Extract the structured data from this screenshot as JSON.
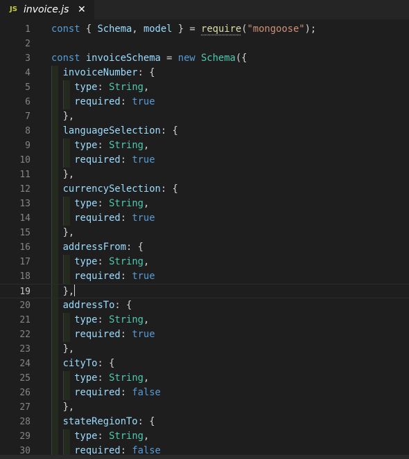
{
  "tab": {
    "badge": "JS",
    "filename": "invoice.js",
    "close_glyph": "✕"
  },
  "editor": {
    "current_line": 19,
    "lines": [
      {
        "n": "1",
        "tokens": [
          {
            "t": "const",
            "c": "kw"
          },
          {
            "t": " { ",
            "c": "pun"
          },
          {
            "t": "Schema",
            "c": "var"
          },
          {
            "t": ", ",
            "c": "pun"
          },
          {
            "t": "model",
            "c": "var"
          },
          {
            "t": " } = ",
            "c": "pun"
          },
          {
            "t": "require",
            "c": "fn squiggle"
          },
          {
            "t": "(",
            "c": "pun"
          },
          {
            "t": "\"mongoose\"",
            "c": "str"
          },
          {
            "t": ");",
            "c": "pun"
          }
        ]
      },
      {
        "n": "2",
        "tokens": []
      },
      {
        "n": "3",
        "tokens": [
          {
            "t": "const",
            "c": "kw"
          },
          {
            "t": " ",
            "c": "pun"
          },
          {
            "t": "invoiceSchema",
            "c": "var"
          },
          {
            "t": " = ",
            "c": "pun"
          },
          {
            "t": "new",
            "c": "kw"
          },
          {
            "t": " ",
            "c": "pun"
          },
          {
            "t": "Schema",
            "c": "cls"
          },
          {
            "t": "({",
            "c": "pun"
          }
        ]
      },
      {
        "n": "4",
        "tokens": [
          {
            "t": "  ",
            "c": "pun"
          },
          {
            "t": "invoiceNumber",
            "c": "prop"
          },
          {
            "t": ": {",
            "c": "pun"
          }
        ]
      },
      {
        "n": "5",
        "tokens": [
          {
            "t": "    ",
            "c": "pun"
          },
          {
            "t": "type",
            "c": "prop"
          },
          {
            "t": ": ",
            "c": "pun"
          },
          {
            "t": "String",
            "c": "cls"
          },
          {
            "t": ",",
            "c": "pun"
          }
        ]
      },
      {
        "n": "6",
        "tokens": [
          {
            "t": "    ",
            "c": "pun"
          },
          {
            "t": "required",
            "c": "prop"
          },
          {
            "t": ": ",
            "c": "pun"
          },
          {
            "t": "true",
            "c": "kw"
          }
        ]
      },
      {
        "n": "7",
        "tokens": [
          {
            "t": "  },",
            "c": "pun"
          }
        ]
      },
      {
        "n": "8",
        "tokens": [
          {
            "t": "  ",
            "c": "pun"
          },
          {
            "t": "languageSelection",
            "c": "prop"
          },
          {
            "t": ": {",
            "c": "pun"
          }
        ]
      },
      {
        "n": "9",
        "tokens": [
          {
            "t": "    ",
            "c": "pun"
          },
          {
            "t": "type",
            "c": "prop"
          },
          {
            "t": ": ",
            "c": "pun"
          },
          {
            "t": "String",
            "c": "cls"
          },
          {
            "t": ",",
            "c": "pun"
          }
        ]
      },
      {
        "n": "10",
        "tokens": [
          {
            "t": "    ",
            "c": "pun"
          },
          {
            "t": "required",
            "c": "prop"
          },
          {
            "t": ": ",
            "c": "pun"
          },
          {
            "t": "true",
            "c": "kw"
          }
        ]
      },
      {
        "n": "11",
        "tokens": [
          {
            "t": "  },",
            "c": "pun"
          }
        ]
      },
      {
        "n": "12",
        "tokens": [
          {
            "t": "  ",
            "c": "pun"
          },
          {
            "t": "currencySelection",
            "c": "prop"
          },
          {
            "t": ": {",
            "c": "pun"
          }
        ]
      },
      {
        "n": "13",
        "tokens": [
          {
            "t": "    ",
            "c": "pun"
          },
          {
            "t": "type",
            "c": "prop"
          },
          {
            "t": ": ",
            "c": "pun"
          },
          {
            "t": "String",
            "c": "cls"
          },
          {
            "t": ",",
            "c": "pun"
          }
        ]
      },
      {
        "n": "14",
        "tokens": [
          {
            "t": "    ",
            "c": "pun"
          },
          {
            "t": "required",
            "c": "prop"
          },
          {
            "t": ": ",
            "c": "pun"
          },
          {
            "t": "true",
            "c": "kw"
          }
        ]
      },
      {
        "n": "15",
        "tokens": [
          {
            "t": "  },",
            "c": "pun"
          }
        ]
      },
      {
        "n": "16",
        "tokens": [
          {
            "t": "  ",
            "c": "pun"
          },
          {
            "t": "addressFrom",
            "c": "prop"
          },
          {
            "t": ": {",
            "c": "pun"
          }
        ]
      },
      {
        "n": "17",
        "tokens": [
          {
            "t": "    ",
            "c": "pun"
          },
          {
            "t": "type",
            "c": "prop"
          },
          {
            "t": ": ",
            "c": "pun"
          },
          {
            "t": "String",
            "c": "cls"
          },
          {
            "t": ",",
            "c": "pun"
          }
        ]
      },
      {
        "n": "18",
        "tokens": [
          {
            "t": "    ",
            "c": "pun"
          },
          {
            "t": "required",
            "c": "prop"
          },
          {
            "t": ": ",
            "c": "pun"
          },
          {
            "t": "true",
            "c": "kw"
          }
        ]
      },
      {
        "n": "19",
        "tokens": [
          {
            "t": "  },",
            "c": "pun"
          }
        ],
        "cursor": true
      },
      {
        "n": "20",
        "tokens": [
          {
            "t": "  ",
            "c": "pun"
          },
          {
            "t": "addressTo",
            "c": "prop"
          },
          {
            "t": ": {",
            "c": "pun"
          }
        ]
      },
      {
        "n": "21",
        "tokens": [
          {
            "t": "    ",
            "c": "pun"
          },
          {
            "t": "type",
            "c": "prop"
          },
          {
            "t": ": ",
            "c": "pun"
          },
          {
            "t": "String",
            "c": "cls"
          },
          {
            "t": ",",
            "c": "pun"
          }
        ]
      },
      {
        "n": "22",
        "tokens": [
          {
            "t": "    ",
            "c": "pun"
          },
          {
            "t": "required",
            "c": "prop"
          },
          {
            "t": ": ",
            "c": "pun"
          },
          {
            "t": "true",
            "c": "kw"
          }
        ]
      },
      {
        "n": "23",
        "tokens": [
          {
            "t": "  },",
            "c": "pun"
          }
        ]
      },
      {
        "n": "24",
        "tokens": [
          {
            "t": "  ",
            "c": "pun"
          },
          {
            "t": "cityTo",
            "c": "prop"
          },
          {
            "t": ": {",
            "c": "pun"
          }
        ]
      },
      {
        "n": "25",
        "tokens": [
          {
            "t": "    ",
            "c": "pun"
          },
          {
            "t": "type",
            "c": "prop"
          },
          {
            "t": ": ",
            "c": "pun"
          },
          {
            "t": "String",
            "c": "cls"
          },
          {
            "t": ",",
            "c": "pun"
          }
        ]
      },
      {
        "n": "26",
        "tokens": [
          {
            "t": "    ",
            "c": "pun"
          },
          {
            "t": "required",
            "c": "prop"
          },
          {
            "t": ": ",
            "c": "pun"
          },
          {
            "t": "false",
            "c": "kw"
          }
        ]
      },
      {
        "n": "27",
        "tokens": [
          {
            "t": "  },",
            "c": "pun"
          }
        ]
      },
      {
        "n": "28",
        "tokens": [
          {
            "t": "  ",
            "c": "pun"
          },
          {
            "t": "stateRegionTo",
            "c": "prop"
          },
          {
            "t": ": {",
            "c": "pun"
          }
        ]
      },
      {
        "n": "29",
        "tokens": [
          {
            "t": "    ",
            "c": "pun"
          },
          {
            "t": "type",
            "c": "prop"
          },
          {
            "t": ": ",
            "c": "pun"
          },
          {
            "t": "String",
            "c": "cls"
          },
          {
            "t": ",",
            "c": "pun"
          }
        ]
      },
      {
        "n": "30",
        "tokens": [
          {
            "t": "    ",
            "c": "pun"
          },
          {
            "t": "required",
            "c": "prop"
          },
          {
            "t": ": ",
            "c": "pun"
          },
          {
            "t": "false",
            "c": "kw"
          }
        ]
      }
    ]
  }
}
